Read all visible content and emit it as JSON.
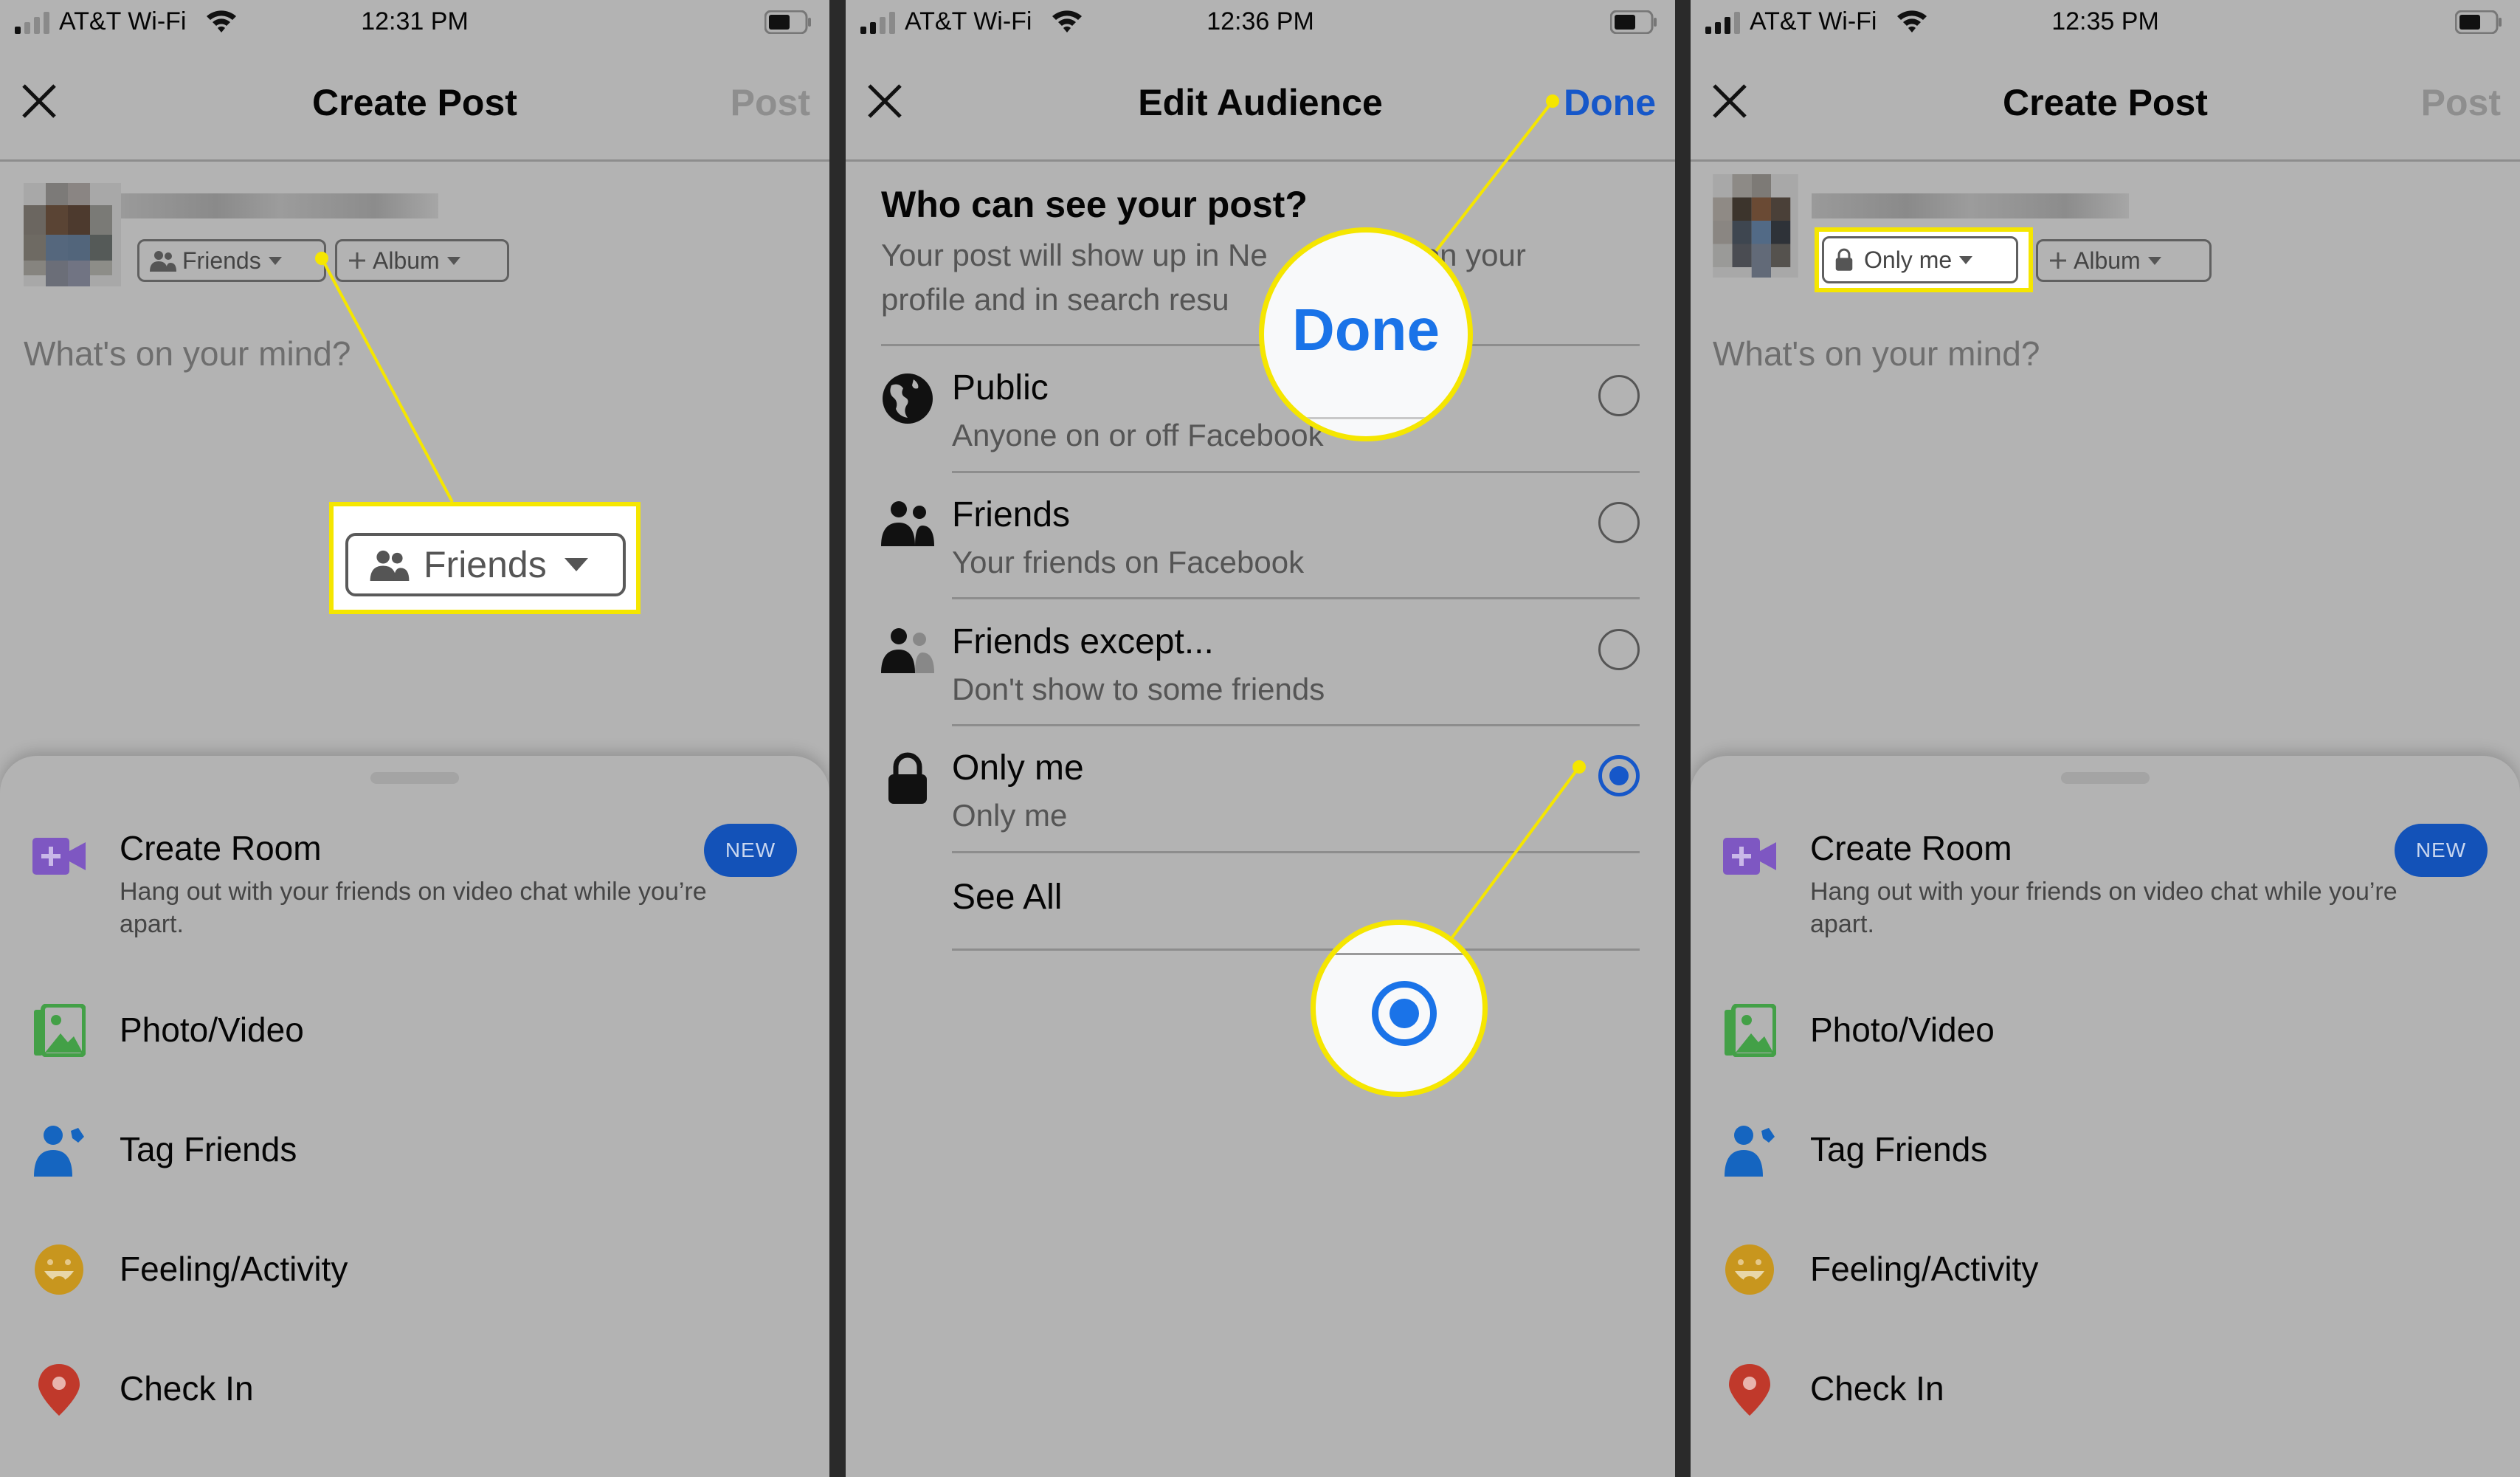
{
  "colors": {
    "accent_blue": "#1657c9",
    "highlight_yellow": "#f5e600",
    "screen_gray": "#b3b3b3",
    "badge_blue": "#1352b8",
    "create_room_purple": "#7e57c2",
    "photo_green": "#43a047",
    "tag_blue": "#1565c0",
    "feeling_yellow": "#c8961e",
    "checkin_red": "#c0392b"
  },
  "panels": [
    {
      "status": {
        "carrier": "AT&T Wi-Fi",
        "time": "12:31 PM"
      },
      "nav": {
        "close_icon": "close-icon",
        "title": "Create Post",
        "action": "Post"
      },
      "composer": {
        "audience_label": "Friends",
        "audience_icon": "friends-icon",
        "album_label": "Album",
        "placeholder": "What's on your mind?"
      },
      "callout": {
        "label": "Friends"
      },
      "sheet": {
        "items": [
          {
            "label": "Create Room",
            "subtitle": "Hang out with your friends on video chat while you’re apart.",
            "badge": "NEW",
            "icon": "video-plus-icon"
          },
          {
            "label": "Photo/Video",
            "icon": "photo-icon"
          },
          {
            "label": "Tag Friends",
            "icon": "tag-friends-icon"
          },
          {
            "label": "Feeling/Activity",
            "icon": "smiley-icon"
          },
          {
            "label": "Check In",
            "icon": "location-pin-icon"
          }
        ]
      }
    },
    {
      "status": {
        "carrier": "AT&T Wi-Fi",
        "time": "12:36 PM"
      },
      "nav": {
        "close_icon": "close-icon",
        "title": "Edit Audience",
        "action": "Done"
      },
      "heading": "Who can see your post?",
      "description": "Your post will show up in News Feed, on your profile and in search results.",
      "description_visible_line1": "Your post will show up in Ne",
      "description_visible_line1_end": "on your",
      "description_visible_line2": "profile and in search resu",
      "options": [
        {
          "label": "Public",
          "subtitle": "Anyone on or off Facebook",
          "icon": "globe-icon",
          "selected": false
        },
        {
          "label": "Friends",
          "subtitle": "Your friends on Facebook",
          "icon": "friends-icon",
          "selected": false
        },
        {
          "label": "Friends except...",
          "subtitle": "Don't show to some friends",
          "icon": "friends-except-icon",
          "selected": false
        },
        {
          "label": "Only me",
          "subtitle": "Only me",
          "icon": "lock-icon",
          "selected": true
        }
      ],
      "see_all": "See All",
      "callout_done": "Done"
    },
    {
      "status": {
        "carrier": "AT&T Wi-Fi",
        "time": "12:35 PM"
      },
      "nav": {
        "close_icon": "close-icon",
        "title": "Create Post",
        "action": "Post"
      },
      "composer": {
        "audience_label": "Only me",
        "audience_icon": "lock-icon",
        "album_label": "Album",
        "placeholder": "What's on your mind?"
      },
      "sheet": {
        "items": [
          {
            "label": "Create Room",
            "subtitle": "Hang out with your friends on video chat while you’re apart.",
            "badge": "NEW",
            "icon": "video-plus-icon"
          },
          {
            "label": "Photo/Video",
            "icon": "photo-icon"
          },
          {
            "label": "Tag Friends",
            "icon": "tag-friends-icon"
          },
          {
            "label": "Feeling/Activity",
            "icon": "smiley-icon"
          },
          {
            "label": "Check In",
            "icon": "location-pin-icon"
          }
        ]
      }
    }
  ]
}
